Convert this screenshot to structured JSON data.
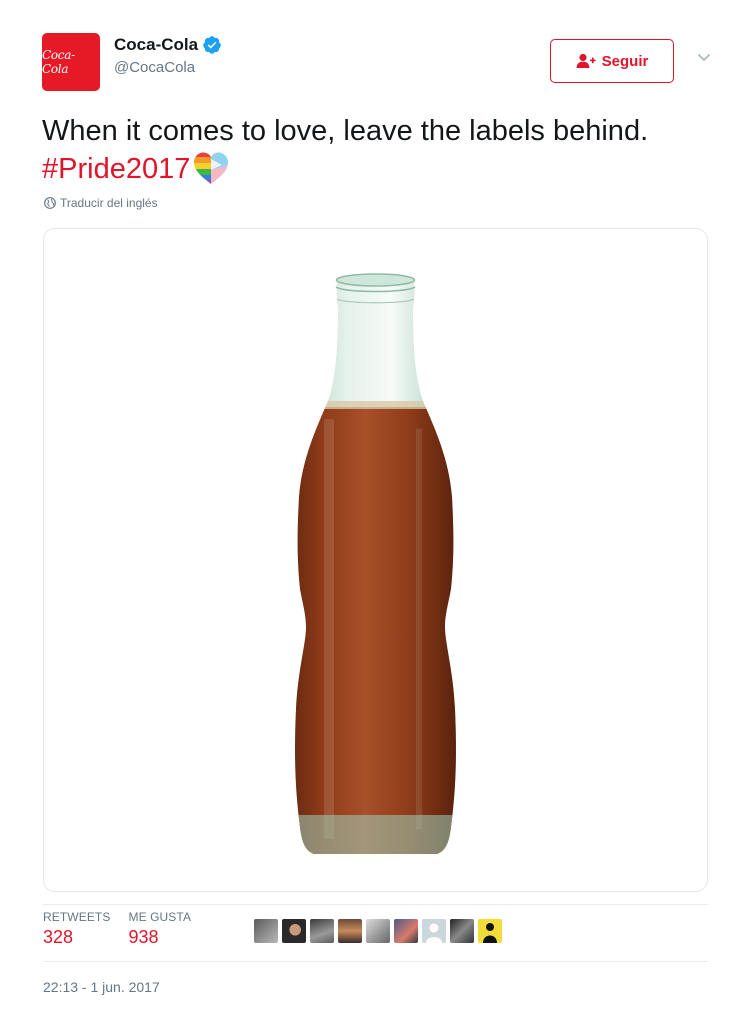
{
  "author": {
    "display_name": "Coca-Cola",
    "handle": "@CocaCola",
    "avatar_text": "Coca-Cola",
    "verified": true
  },
  "follow_button": {
    "label": "Seguir",
    "icon": "add-user-icon"
  },
  "more_menu": {
    "icon": "chevron-down-icon"
  },
  "tweet": {
    "text": "When it comes to love, leave the labels behind.",
    "hashtag": "#Pride2017",
    "emoji": "rainbow-heart-emoji"
  },
  "translate": {
    "label": "Traducir del inglés",
    "icon": "globe-icon"
  },
  "media": {
    "subject": "glass-cola-bottle-image"
  },
  "stats": {
    "retweets_label": "RETWEETS",
    "retweets_count": "328",
    "likes_label": "ME GUSTA",
    "likes_count": "938"
  },
  "likers_count_shown": 9,
  "timestamp": "22:13 - 1 jun. 2017",
  "colors": {
    "accent": "#e0152a",
    "brand_red": "#e61a27",
    "verified_blue": "#1da1f2",
    "muted_text": "#657786"
  }
}
